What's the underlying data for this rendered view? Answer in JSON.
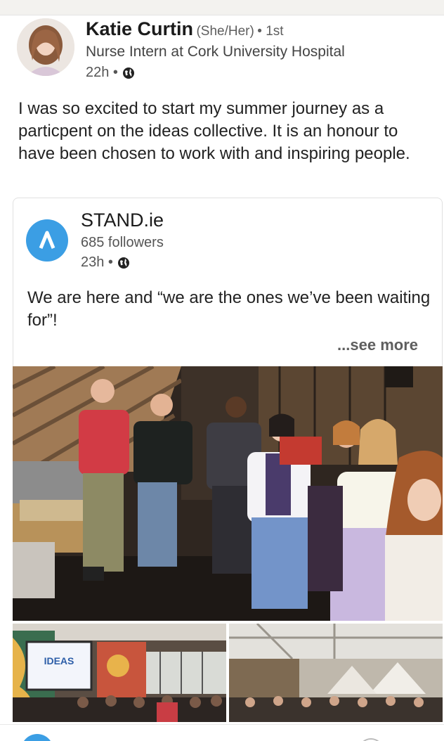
{
  "post": {
    "author": {
      "name": "Katie Curtin",
      "pronouns": "(She/Her)",
      "degree": "• 1st",
      "headline": "Nurse Intern at Cork University Hospital",
      "time": "22h •",
      "visibility_icon": "globe-icon"
    },
    "text": "I was so excited to start my summer journey as a particpent on the ideas collective. It is  an honour to have been chosen to work with and inspiring people.",
    "shared": {
      "org_name": "STAND.ie",
      "followers": "685 followers",
      "time": "23h •",
      "visibility_icon": "globe-icon",
      "text": "We are here and “we are the ones we’ve been waiting for”!",
      "see_more": "...see more",
      "logo_color": "#3b9ee4"
    },
    "images": {
      "main": "group-photo",
      "thumbnails": [
        "projector-room-photo",
        "cafe-room-photo"
      ],
      "projector_slide_text": "IDEAS"
    }
  }
}
